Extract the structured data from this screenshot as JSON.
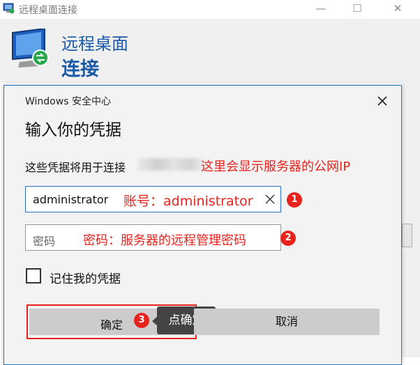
{
  "window": {
    "title": "远程桌面连接",
    "heading_line1": "远程桌面",
    "heading_line2": "连接",
    "controls": {
      "minimize": "—",
      "maximize": "☐",
      "close": "✕"
    }
  },
  "dialog": {
    "caption": "Windows 安全中心",
    "title": "输入你的凭据",
    "description": "这些凭据将用于连接",
    "username_value": "administrator",
    "password_placeholder": "密码",
    "remember_label": "记住我的凭据",
    "ok_label": "确定",
    "cancel_label": "取消"
  },
  "annotations": {
    "ip_note": "这里会显示服务器的公网IP",
    "username_note": "账号：administrator",
    "password_note": "密码：服务器的远程管理密码",
    "step1": "1",
    "step2": "2",
    "step3": "3",
    "tooltip": "点确定"
  },
  "colors": {
    "accent_blue": "#1a5aa8",
    "annotation_red": "#e8221c",
    "dialog_border": "#1979ca"
  },
  "icons": [
    "remote-desktop-app-icon",
    "remote-desktop-monitor-icon",
    "close-icon",
    "clear-field-icon",
    "checkbox-icon"
  ]
}
